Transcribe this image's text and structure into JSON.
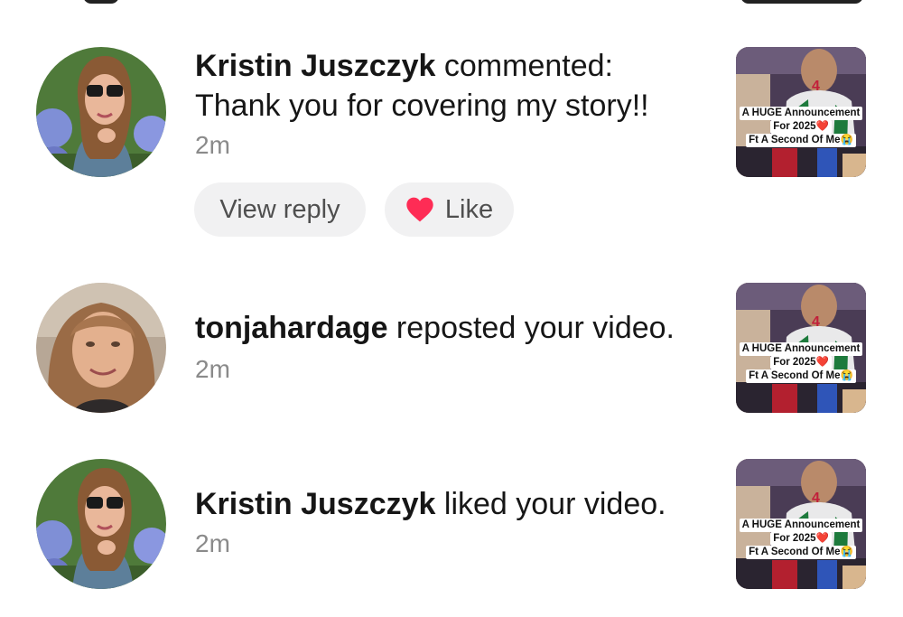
{
  "notifications": [
    {
      "username": "Kristin Juszczyk",
      "action": " commented:",
      "comment": "Thank you for covering my story!!",
      "time": "2m",
      "buttons": {
        "view_reply": "View reply",
        "like": "Like"
      }
    },
    {
      "username": "tonjahardage",
      "action": " reposted your video.",
      "time": "2m"
    },
    {
      "username": "Kristin Juszczyk",
      "action": " liked your video.",
      "time": "2m"
    }
  ],
  "thumbnail": {
    "line1": "A HUGE Announcement",
    "line2": "For 2025❤️",
    "line3": "Ft A Second Of Me😭"
  },
  "colors": {
    "like_heart": "#fe2c55",
    "pill_bg": "#f1f1f2",
    "timestamp": "#8a8a8a"
  }
}
